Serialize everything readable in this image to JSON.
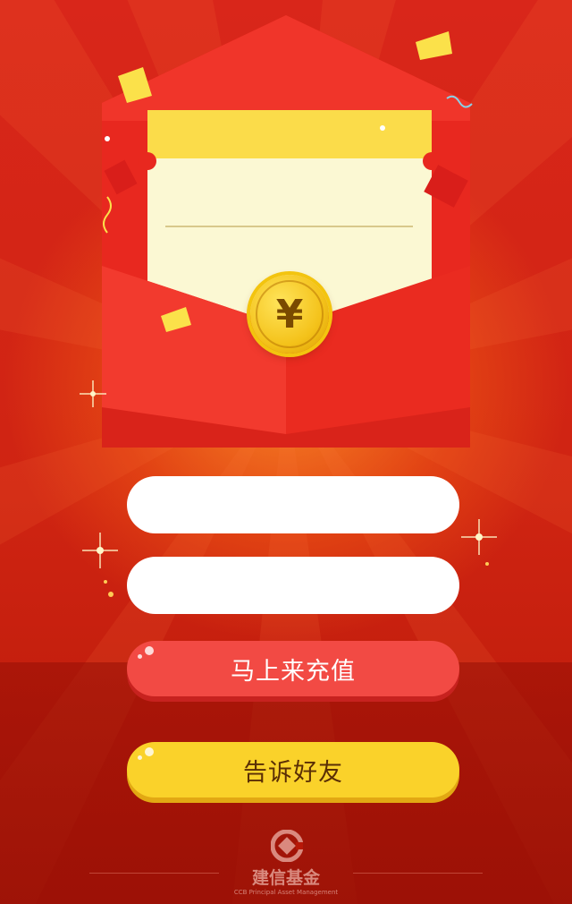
{
  "envelope": {
    "currency_symbol": "¥"
  },
  "form": {
    "field_1": {
      "value": "",
      "placeholder": ""
    },
    "field_2": {
      "value": "",
      "placeholder": ""
    }
  },
  "buttons": {
    "recharge_label": "马上来充值",
    "share_label": "告诉好友"
  },
  "footer": {
    "logo_cn": "建信基金",
    "logo_en": "CCB Principal Asset Management"
  },
  "colors": {
    "background": "#cf2412",
    "recharge_button": "#f24a44",
    "share_button": "#fad22a",
    "coin": "#f4c21a"
  },
  "icons": [
    "yuan-coin-icon",
    "ccb-logo-icon"
  ]
}
